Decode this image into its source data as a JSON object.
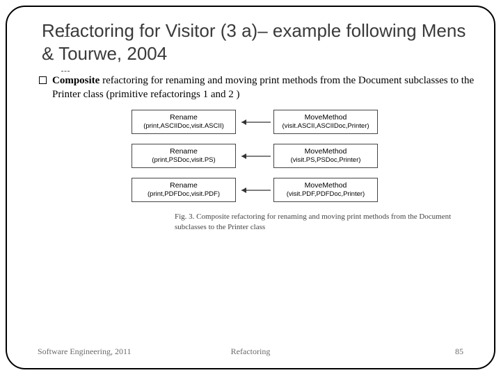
{
  "title": "Refactoring for Visitor (3 a)–  example following Mens & Tourwe, 2004",
  "bullet": {
    "bold": "Composite",
    "rest": " refactoring for renaming and moving print methods from the Document subclasses to the Printer class (primitive refactorings 1 and 2 )"
  },
  "rows": [
    {
      "left_hd": "Rename",
      "left_args": "(print,ASCIIDoc,visit.ASCII)",
      "right_hd": "MoveMethod",
      "right_args": "(visit.ASCII,ASCIIDoc,Printer)"
    },
    {
      "left_hd": "Rename",
      "left_args": "(print,PSDoc,visit.PS)",
      "right_hd": "MoveMethod",
      "right_args": "(visit.PS,PSDoc,Printer)"
    },
    {
      "left_hd": "Rename",
      "left_args": "(print,PDFDoc,visit.PDF)",
      "right_hd": "MoveMethod",
      "right_args": "(visit.PDF,PDFDoc,Printer)"
    }
  ],
  "caption": "Fig. 3.  Composite refactoring for renaming and moving print methods from the Document subclasses to the Printer class",
  "footer": {
    "left": "Software Engineering, 2011",
    "mid": "Refactoring",
    "right": "85"
  }
}
